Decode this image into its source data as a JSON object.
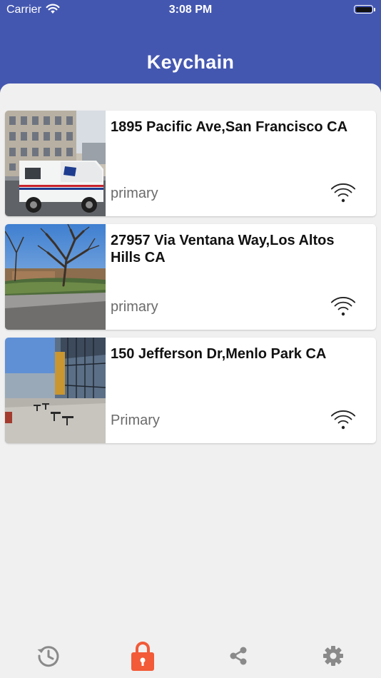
{
  "status_bar": {
    "carrier": "Carrier",
    "time": "3:08 PM"
  },
  "header": {
    "title": "Keychain"
  },
  "keychain": [
    {
      "address": "1895 Pacific Ave,San Francisco CA",
      "type": "primary",
      "icon": "wifi-icon"
    },
    {
      "address": "27957 Via Ventana Way,Los Altos Hills CA",
      "type": "primary",
      "icon": "wifi-icon"
    },
    {
      "address": "150 Jefferson Dr,Menlo Park CA",
      "type": "Primary",
      "icon": "wifi-icon"
    }
  ],
  "tabbar": {
    "tabs": [
      {
        "name": "history",
        "icon": "history-icon",
        "active": false
      },
      {
        "name": "keychain",
        "icon": "lock-icon",
        "active": true
      },
      {
        "name": "share",
        "icon": "share-icon",
        "active": false
      },
      {
        "name": "settings",
        "icon": "gear-icon",
        "active": false
      }
    ]
  },
  "colors": {
    "header": "#4457b0",
    "active_tab": "#f25a38",
    "inactive_tab": "#8a8a8a",
    "background": "#f0f0f0"
  }
}
